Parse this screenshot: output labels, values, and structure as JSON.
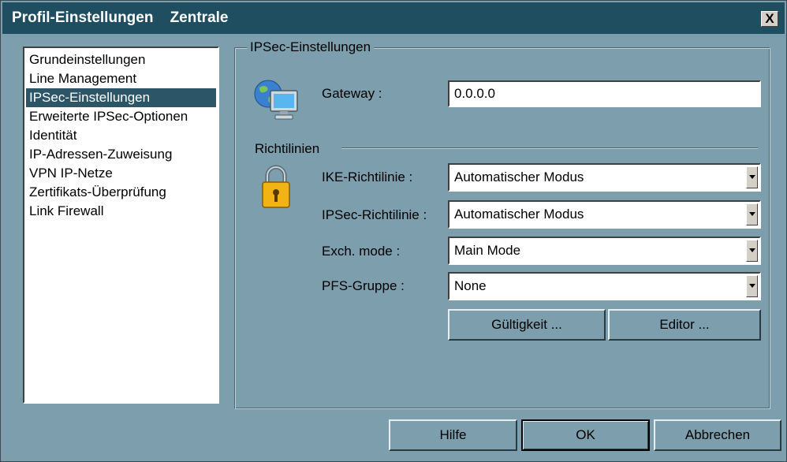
{
  "window": {
    "title": "Profil-Einstellungen    Zentrale",
    "close_label": "X"
  },
  "sidebar": {
    "items": [
      {
        "label": "Grundeinstellungen",
        "selected": false
      },
      {
        "label": "Line Management",
        "selected": false
      },
      {
        "label": "IPSec-Einstellungen",
        "selected": true
      },
      {
        "label": "Erweiterte IPSec-Optionen",
        "selected": false
      },
      {
        "label": "Identität",
        "selected": false
      },
      {
        "label": "IP-Adressen-Zuweisung",
        "selected": false
      },
      {
        "label": "VPN IP-Netze",
        "selected": false
      },
      {
        "label": "Zertifikats-Überprüfung",
        "selected": false
      },
      {
        "label": "Link Firewall",
        "selected": false
      }
    ]
  },
  "group": {
    "legend": "IPSec-Einstellungen",
    "gateway": {
      "label": "Gateway :",
      "value": "0.0.0.0"
    },
    "section_label": "Richtilinien",
    "ike": {
      "label": "IKE-Richtilinie :",
      "value": "Automatischer Modus"
    },
    "ipsec": {
      "label": "IPSec-Richtilinie :",
      "value": "Automatischer Modus"
    },
    "exch": {
      "label": "Exch. mode :",
      "value": "Main Mode"
    },
    "pfs": {
      "label": "PFS-Gruppe :",
      "value": "None"
    },
    "validity_button": "Gültigkeit ...",
    "editor_button": "Editor ..."
  },
  "footer": {
    "help": "Hilfe",
    "ok": "OK",
    "cancel": "Abbrechen"
  },
  "icons": {
    "gateway": "computer-globe-icon",
    "policies": "padlock-icon"
  },
  "colors": {
    "titlebar": "#1f4e60",
    "dialog": "#7d9eac",
    "selection": "#2c5568"
  }
}
